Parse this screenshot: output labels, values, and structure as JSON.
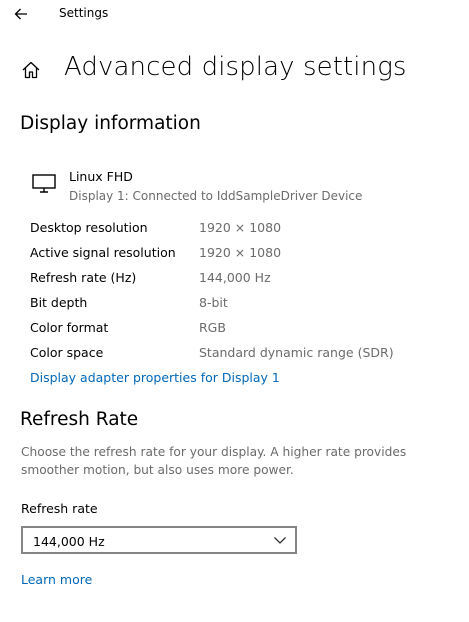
{
  "window": {
    "app_title": "Settings"
  },
  "header": {
    "page_title": "Advanced display settings"
  },
  "display_info": {
    "section_title": "Display information",
    "display_name": "Linux FHD",
    "display_connection": "Display 1: Connected to IddSampleDriver Device",
    "rows": [
      {
        "label": "Desktop resolution",
        "value": "1920 × 1080"
      },
      {
        "label": "Active signal resolution",
        "value": "1920 × 1080"
      },
      {
        "label": "Refresh rate (Hz)",
        "value": "144,000 Hz"
      },
      {
        "label": "Bit depth",
        "value": "8-bit"
      },
      {
        "label": "Color format",
        "value": "RGB"
      },
      {
        "label": "Color space",
        "value": "Standard dynamic range (SDR)"
      }
    ],
    "adapter_link": "Display adapter properties for Display 1"
  },
  "refresh_rate": {
    "section_title": "Refresh Rate",
    "description": "Choose the refresh rate for your display. A higher rate provides smoother motion, but also uses more power.",
    "field_label": "Refresh rate",
    "selected_value": "144,000 Hz",
    "learn_more": "Learn more"
  },
  "icons": {
    "back": "back-arrow-icon",
    "home": "home-icon",
    "monitor": "monitor-icon",
    "dropdown": "chevron-down-icon"
  },
  "colors": {
    "link": "#0067b8",
    "secondary_text": "#6b6b6b",
    "border": "#858585"
  }
}
